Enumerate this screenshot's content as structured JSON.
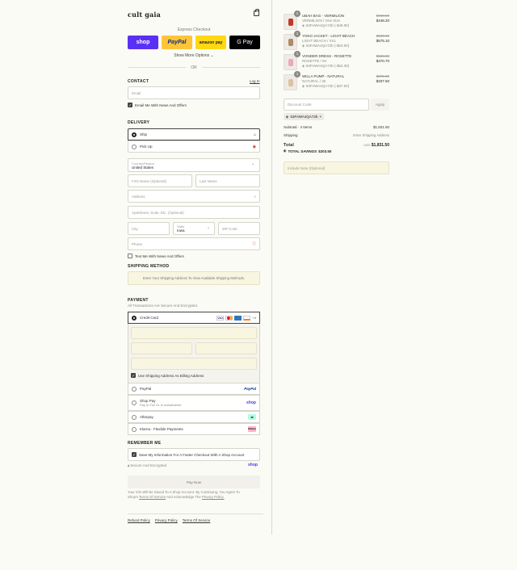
{
  "brand": {
    "logo_text": "cult gaia"
  },
  "express": {
    "label": "Express Checkout",
    "buttons": [
      {
        "label": "shop",
        "color": "#5a31f4"
      },
      {
        "label": "PayPal",
        "color": "#ffc439"
      },
      {
        "label": "amazon pay",
        "color": "#ffd814"
      },
      {
        "label": "G Pay",
        "color": "#000000"
      }
    ],
    "more_options": "Show More Options",
    "or": "OR"
  },
  "contact": {
    "title": "CONTACT",
    "login": "Log In",
    "email_placeholder": "Email",
    "news_label": "Email Me With News And Offers"
  },
  "delivery": {
    "title": "DELIVERY",
    "ship": "Ship",
    "pickup": "Pick Up",
    "country_label": "Country/Region",
    "country_value": "United States",
    "first_name": "First Name (Optional)",
    "last_name": "Last Name",
    "address": "Address",
    "apartment": "Apartment, Suite, Etc. (Optional)",
    "city": "City",
    "state_label": "State",
    "state_value": "Iowa",
    "zip": "ZIP Code",
    "phone": "Phone",
    "text_label": "Text Me With News And Offers"
  },
  "shipping_method": {
    "title": "SHIPPING METHOD",
    "message": "Enter Your Shipping Address To View Available Shipping Methods."
  },
  "payment": {
    "title": "PAYMENT",
    "subtitle": "All Transactions Are Secure And Encrypted.",
    "credit_card": "Credit Card",
    "billing_label": "Use Shipping Address As Billing Address",
    "options": [
      {
        "label": "PayPal",
        "sub": "",
        "badge": "PayPal"
      },
      {
        "label": "Shop Pay",
        "sub": "Pay In Full Or In Installments",
        "badge": "shop"
      },
      {
        "label": "Afterpay",
        "sub": "",
        "badge": "afterpay"
      },
      {
        "label": "Klarna - Flexible Payments",
        "sub": "",
        "badge": "Klarna"
      }
    ]
  },
  "remember": {
    "title": "REMEMBER ME",
    "save_label": "Save My Information For A Faster Checkout With A Shop Account",
    "secure": "Secure And Encrypted",
    "shop_badge": "shop"
  },
  "pay_now": "Pay Now",
  "legal": {
    "line1": "Your Info Will Be Saved To A Shop Account. By Continuing, You Agree To",
    "line2_a": "Shop's",
    "terms": "Terms Of Service",
    "line2_b": "And Acknowledge The",
    "privacy": "Privacy Policy."
  },
  "footer": {
    "links": [
      "Refund Policy",
      "Privacy Policy",
      "Terms Of Service"
    ]
  },
  "cart": {
    "items": [
      {
        "qty": "1",
        "name": "UBAH BAG - VERMILION",
        "variant": "VERMILION / One Size",
        "code": "63FAWA4QA72b (-$49.80)",
        "old": "$498.00",
        "price": "$448.20",
        "thumb_color": "#c0392b"
      },
      {
        "qty": "1",
        "name": "YOKO JACKET - LIGHT BEACH",
        "variant": "LIGHT BEACH / XXL",
        "code": "63FAWA4QA72b (-$63.90)",
        "old": "$639.00",
        "price": "$575.10",
        "thumb_color": "#b08a6a"
      },
      {
        "qty": "1",
        "name": "VONDER DRESS - ROSETTE",
        "variant": "ROSETTE / 00",
        "code": "63FAWA4QA72b (-$52.30)",
        "old": "$523.00",
        "price": "$470.70",
        "thumb_color": "#e8a9c0"
      },
      {
        "qty": "1",
        "name": "WILLA PUMP - NATURAL",
        "variant": "NATURAL / 35",
        "code": "63FAWA4QA72b (-$37.50)",
        "old": "$375.00",
        "price": "$337.50",
        "thumb_color": "#d9c3a0"
      }
    ],
    "discount_placeholder": "Discount Code",
    "apply": "Apply",
    "tag": "63FAWA4QA72b",
    "subtotal_label": "Subtotal · 4 Items",
    "subtotal_value": "$1,831.50",
    "shipping_label": "Shipping",
    "shipping_value": "Enter Shipping Address",
    "total_label": "Total",
    "currency": "USD",
    "total_value": "$1,831.50",
    "savings_label": "TOTAL SAVINGS",
    "savings_value": "$203.50",
    "note_placeholder": "Include Note (Optional)"
  }
}
